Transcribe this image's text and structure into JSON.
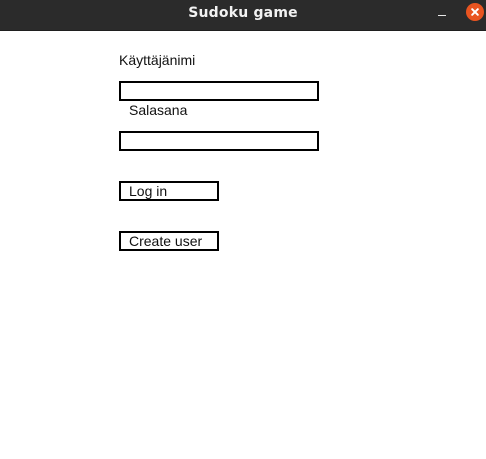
{
  "window": {
    "title": "Sudoku game"
  },
  "form": {
    "username_label": "Käyttäjänimi",
    "username_value": "",
    "password_label": "Salasana",
    "password_value": "",
    "login_label": "Log in",
    "create_user_label": "Create user"
  }
}
